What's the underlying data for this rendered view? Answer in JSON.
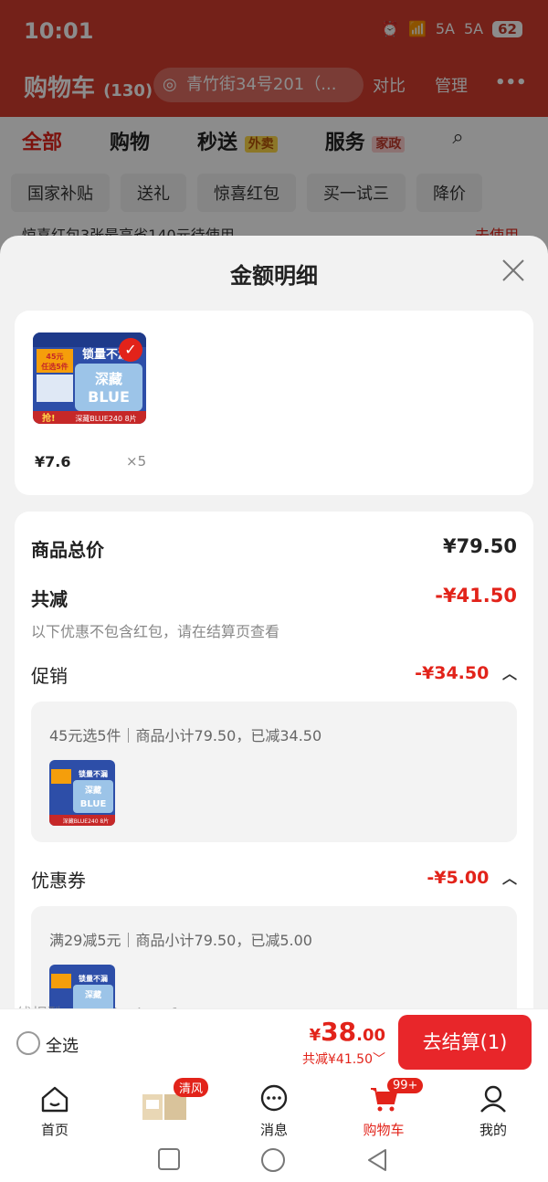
{
  "status": {
    "time": "10:01",
    "signal1": "5A",
    "signal2": "5A",
    "battery": "62"
  },
  "bg": {
    "title": "购物车",
    "count": "(130)",
    "address": "青竹街34号201（...",
    "compare": "对比",
    "manage": "管理",
    "tabs": [
      "全部",
      "购物",
      "秒送",
      "服务"
    ],
    "tab_tags": {
      "miaosong": "外卖",
      "fuwu": "家政"
    },
    "chips": [
      "国家补贴",
      "送礼",
      "惊喜红包",
      "买一试三",
      "降价"
    ],
    "redbar": "惊喜红包3张最高省140元待使用",
    "redbar_action": "去使用"
  },
  "sheet": {
    "title": "金额明细",
    "product": {
      "price": "¥7.6",
      "qty": "×5",
      "thumb_text": [
        "锁量不漏",
        "45元",
        "任选5件",
        "深藏",
        "BLUE",
        "抢!",
        "深藏BLUE240 8片"
      ]
    },
    "total_label": "商品总价",
    "total_value": "¥79.50",
    "discount_label": "共减",
    "discount_value": "-¥41.50",
    "note": "以下优惠不包含红包，请在结算页查看",
    "promo_label": "促销",
    "promo_value": "-¥34.50",
    "promo_desc": "45元选5件｜商品小计79.50，已减34.50",
    "coupon_label": "优惠券",
    "coupon_value": "-¥5.00",
    "coupon_desc": "满29减5元｜商品小计79.50，已减5.00"
  },
  "watermark": "线报酷-new.xianbao.fun",
  "bottom": {
    "select_all": "全选",
    "yen": "¥",
    "amount_int": "38",
    "amount_dec": ".00",
    "saving": "共减¥41.50",
    "checkout": "去结算(1)"
  },
  "nav": {
    "items": [
      "首页",
      "",
      "消息",
      "购物车",
      "我的"
    ],
    "badge_cart": "99+",
    "badge_promo": "清风"
  },
  "colors": {
    "accent": "#e2231a",
    "sheet_bg": "#f2f2f2"
  }
}
